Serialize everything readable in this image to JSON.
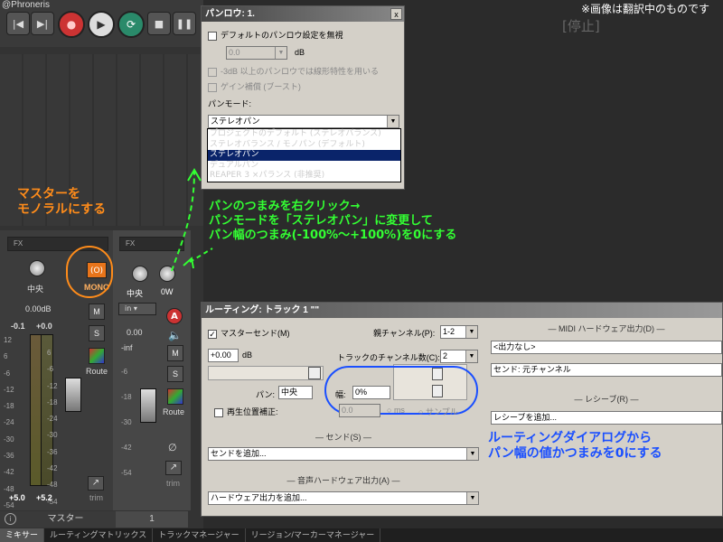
{
  "app": {
    "brand": "@Phroneris",
    "stopped_label": "[停止]",
    "note": "※画像は翻訳中のものです"
  },
  "transport": {
    "prev": "|◀",
    "next": "▶|",
    "record": "●",
    "play": "▶",
    "loop": "⟳",
    "stop": "■",
    "pause": "❚❚"
  },
  "mixer": {
    "master": {
      "fx_label": "FX",
      "pan_label": "中央",
      "mono_label": "MONO",
      "mono_icon": "(O)",
      "volume": "0.00dB",
      "peak_left": "-0.1",
      "peak_right": "+0.0",
      "m_label": "M",
      "s_label": "S",
      "route_label": "Route",
      "bottom_left": "+5.0",
      "bottom_right": "+5.2",
      "trim_label": "trim",
      "name": "マスター",
      "scale": [
        "12",
        "6",
        "-6",
        "-12",
        "-18",
        "-24",
        "-30",
        "-36",
        "-42",
        "-48",
        "-54",
        "-60"
      ],
      "scale2": [
        "6",
        "-6",
        "-12",
        "-18",
        "-24",
        "-30",
        "-36",
        "-42",
        "-48",
        "-54",
        "-60"
      ]
    },
    "track1": {
      "fx_label": "FX",
      "pan_label": "中央",
      "width_label": "0W",
      "volume": "0.00",
      "in_label": "in",
      "m_label": "M",
      "s_label": "S",
      "route_label": "Route",
      "peak": "-inf",
      "scale": [
        "-6",
        "-18",
        "-30",
        "-42",
        "-54"
      ],
      "phase_icon": "∅",
      "trim_label": "trim",
      "number": "1"
    }
  },
  "tabs": [
    "ミキサー",
    "ルーティングマトリックス",
    "トラックマネージャー",
    "リージョン/マーカーマネージャー"
  ],
  "pan_dialog": {
    "title": "パンロウ: 1.",
    "close": "x",
    "override_label": "デフォルトのパンロウ設定を無視",
    "db_value": "0.0",
    "db_unit": "dB",
    "linear_label": "-3dB 以上のパンロウでは線形特性を用いる",
    "gain_label": "ゲイン補償 (ブースト)",
    "mode_label": "パンモード:",
    "mode_selected": "ステレオパン",
    "options": [
      "プロジェクトのデフォルト (ステレオバランス)",
      "ステレオバランス / モノパン (デフォルト)",
      "ステレオパン",
      "デュアルパン",
      "REAPER 3 ×パランス (非推奨)"
    ]
  },
  "routing_dialog": {
    "title": "ルーティング: トラック 1 \"\"",
    "master_send_label": "マスターセンド(M)",
    "parent_ch_label": "親チャンネル(P):",
    "parent_ch_value": "1-2",
    "track_ch_label": "トラックのチャンネル数(C):",
    "track_ch_value": "2",
    "vol_value": "+0.00",
    "vol_unit": "dB",
    "pan_label": "パン:",
    "pan_value": "中央",
    "width_label": "幅:",
    "width_value": "0%",
    "playback_offset_label": "再生位置補正:",
    "offset_value": "0.0",
    "ms_label": "ms",
    "samples_label": "サンプル",
    "sends_header": "センド(S)",
    "add_send": "センドを追加...",
    "audio_hw_header": "音声ハードウェア出力(A)",
    "add_hw": "ハードウェア出力を追加...",
    "midi_hw_header": "MIDI ハードウェア出力(D)",
    "midi_out": "<出力なし>",
    "send_original": "センド: 元チャンネル",
    "receives_header": "レシーブ(R)",
    "add_receive": "レシーブを追加..."
  },
  "annotations": {
    "orange": "マスターを\nモノラルにする",
    "green": "パンのつまみを右クリック→\nパンモードを「ステレオパン」に変更して\nパン幅のつまみ(-100%〜+100%)を0にする",
    "blue": "ルーティングダイアログから\nパン幅の値かつまみを0にする"
  },
  "colors": {
    "orange": "#ff8c1a",
    "green": "#33ff33",
    "blue": "#1a4fff"
  }
}
